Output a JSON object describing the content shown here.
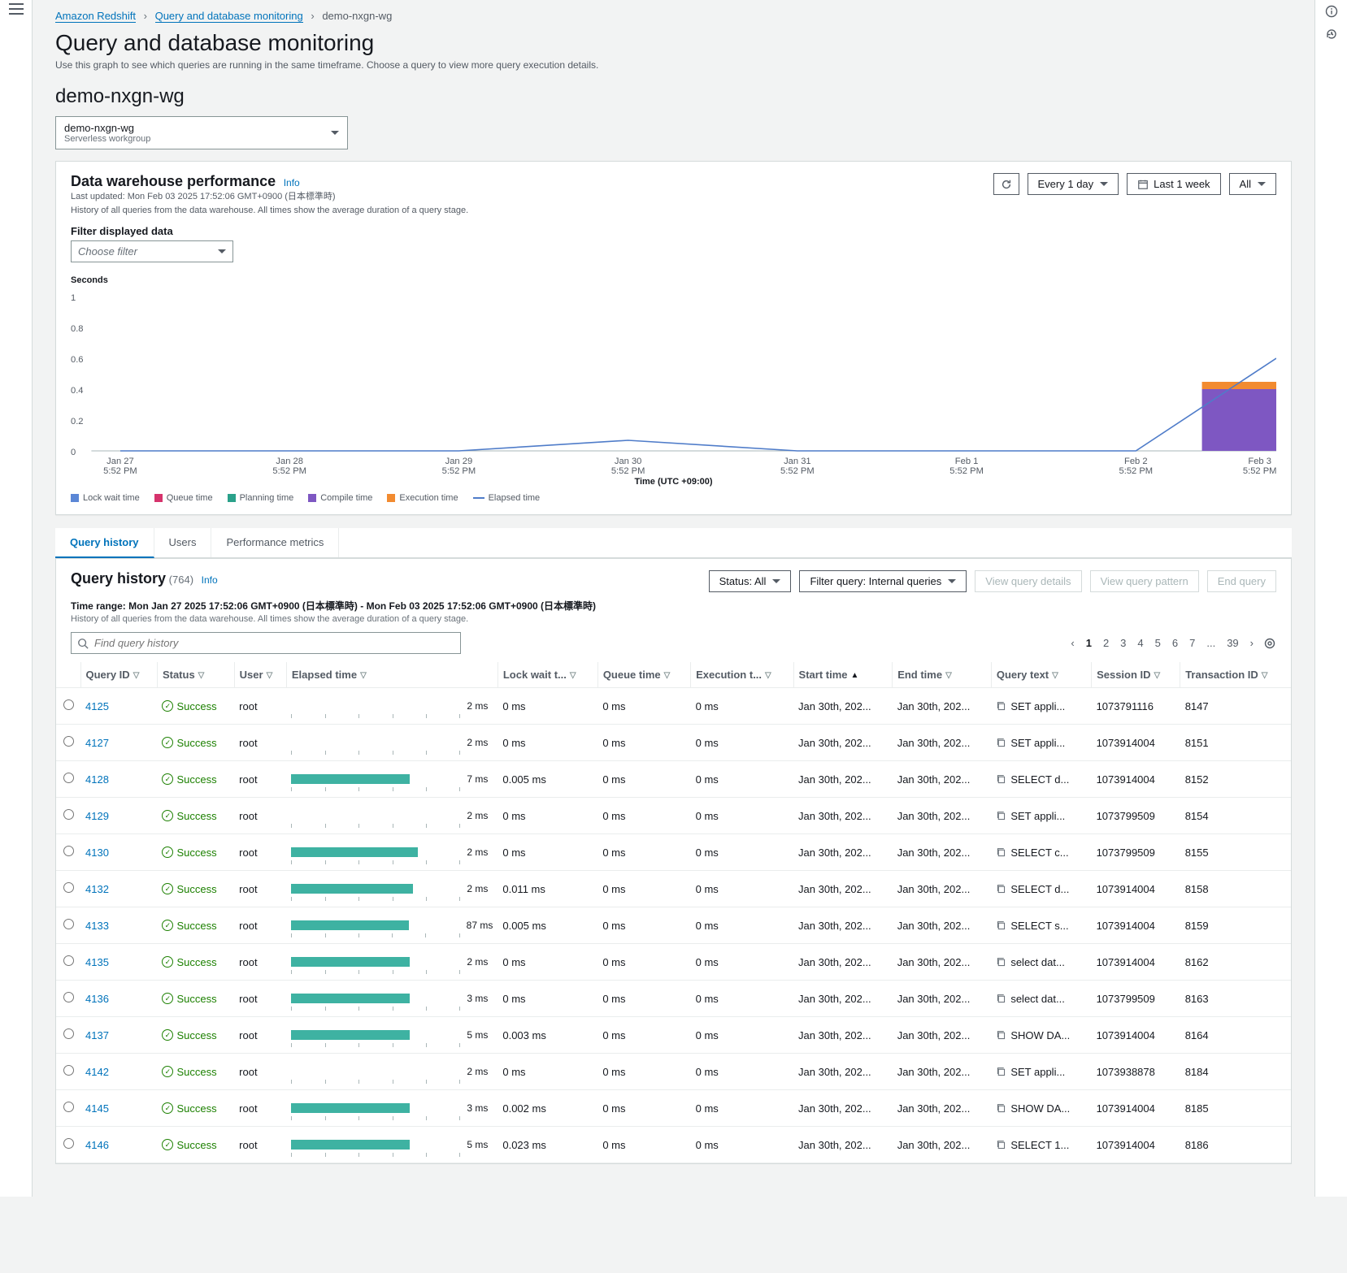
{
  "breadcrumb": {
    "root": "Amazon Redshift",
    "mid": "Query and database monitoring",
    "current": "demo-nxgn-wg"
  },
  "page": {
    "title": "Query and database monitoring",
    "desc": "Use this graph to see which queries are running in the same timeframe. Choose a query to view more query execution details.",
    "section": "demo-nxgn-wg"
  },
  "workgroup": {
    "name": "demo-nxgn-wg",
    "type": "Serverless workgroup"
  },
  "perf": {
    "title": "Data warehouse performance",
    "info": "Info",
    "sub1": "Last updated: Mon Feb 03 2025 17:52:06 GMT+0900 (日本標準時)",
    "sub2": "History of all queries from the data warehouse. All times show the average duration of a query stage.",
    "refresh": "",
    "interval": "Every 1 day",
    "range": "Last 1 week",
    "all": "All",
    "filter_label": "Filter displayed data",
    "filter_placeholder": "Choose filter",
    "ylabel": "Seconds",
    "xlabel": "Time (UTC +09:00)"
  },
  "chart_data": {
    "type": "line",
    "title": "Data warehouse performance",
    "xlabel": "Time (UTC +09:00)",
    "ylabel": "Seconds",
    "ylim": [
      0,
      1
    ],
    "categories": [
      "Jan 27 5:52 PM",
      "Jan 28 5:52 PM",
      "Jan 29 5:52 PM",
      "Jan 30 5:52 PM",
      "Jan 31 5:52 PM",
      "Feb 1 5:52 PM",
      "Feb 2 5:52 PM",
      "Feb 3 5:52 PM"
    ],
    "series": [
      {
        "name": "Lock wait time",
        "type": "bar",
        "color": "#5b87d6",
        "values": [
          0,
          0,
          0,
          0,
          0,
          0,
          0,
          0
        ]
      },
      {
        "name": "Queue time",
        "type": "bar",
        "color": "#d6336c",
        "values": [
          0,
          0,
          0,
          0,
          0,
          0,
          0,
          0
        ]
      },
      {
        "name": "Planning time",
        "type": "bar",
        "color": "#2aa18a",
        "values": [
          0,
          0,
          0,
          0,
          0,
          0,
          0,
          0
        ]
      },
      {
        "name": "Compile time",
        "type": "bar",
        "color": "#7e57c2",
        "values": [
          0,
          0,
          0,
          0,
          0,
          0,
          0,
          0.4
        ]
      },
      {
        "name": "Execution time",
        "type": "bar",
        "color": "#f28b30",
        "values": [
          0,
          0,
          0,
          0,
          0,
          0,
          0,
          0.05
        ]
      },
      {
        "name": "Elapsed time",
        "type": "line",
        "color": "#4f7cc9",
        "values": [
          0,
          0,
          0,
          0.07,
          0,
          0,
          0,
          0.6
        ]
      }
    ],
    "legend": [
      "Lock wait time",
      "Queue time",
      "Planning time",
      "Compile time",
      "Execution time",
      "Elapsed time"
    ]
  },
  "tabs": {
    "t1": "Query history",
    "t2": "Users",
    "t3": "Performance metrics"
  },
  "qh": {
    "title": "Query history",
    "count": "(764)",
    "info": "Info",
    "status_btn": "Status: All",
    "filter_btn": "Filter query: Internal queries",
    "btn_details": "View query details",
    "btn_pattern": "View query pattern",
    "btn_end": "End query",
    "time_range": "Time range: Mon Jan 27 2025 17:52:06 GMT+0900 (日本標準時) - Mon Feb 03 2025 17:52:06 GMT+0900 (日本標準時)",
    "desc": "History of all queries from the data warehouse. All times show the average duration of a query stage.",
    "search_placeholder": "Find query history"
  },
  "pagination": {
    "pages": [
      "1",
      "2",
      "3",
      "4",
      "5",
      "6",
      "7",
      "...",
      "39"
    ]
  },
  "cols": {
    "qid": "Query ID",
    "status": "Status",
    "user": "User",
    "elapsed": "Elapsed time",
    "lock": "Lock wait t...",
    "queue": "Queue time",
    "exec": "Execution t...",
    "start": "Start time",
    "end": "End time",
    "qtext": "Query text",
    "session": "Session ID",
    "txn": "Transaction ID"
  },
  "rows": [
    {
      "id": "4125",
      "status": "Success",
      "user": "root",
      "bar": 0,
      "elapsed": "2 ms",
      "lock": "0 ms",
      "queue": "0 ms",
      "exec": "0 ms",
      "start": "Jan 30th, 202...",
      "end": "Jan 30th, 202...",
      "qtext": "SET appli...",
      "session": "1073791116",
      "txn": "8147"
    },
    {
      "id": "4127",
      "status": "Success",
      "user": "root",
      "bar": 0,
      "elapsed": "2 ms",
      "lock": "0 ms",
      "queue": "0 ms",
      "exec": "0 ms",
      "start": "Jan 30th, 202...",
      "end": "Jan 30th, 202...",
      "qtext": "SET appli...",
      "session": "1073914004",
      "txn": "8151"
    },
    {
      "id": "4128",
      "status": "Success",
      "user": "root",
      "bar": 70,
      "elapsed": "7 ms",
      "lock": "0.005 ms",
      "queue": "0 ms",
      "exec": "0 ms",
      "start": "Jan 30th, 202...",
      "end": "Jan 30th, 202...",
      "qtext": "SELECT d...",
      "session": "1073914004",
      "txn": "8152"
    },
    {
      "id": "4129",
      "status": "Success",
      "user": "root",
      "bar": 0,
      "elapsed": "2 ms",
      "lock": "0 ms",
      "queue": "0 ms",
      "exec": "0 ms",
      "start": "Jan 30th, 202...",
      "end": "Jan 30th, 202...",
      "qtext": "SET appli...",
      "session": "1073799509",
      "txn": "8154"
    },
    {
      "id": "4130",
      "status": "Success",
      "user": "root",
      "bar": 75,
      "elapsed": "2 ms",
      "lock": "0 ms",
      "queue": "0 ms",
      "exec": "0 ms",
      "start": "Jan 30th, 202...",
      "end": "Jan 30th, 202...",
      "qtext": "SELECT c...",
      "session": "1073799509",
      "txn": "8155"
    },
    {
      "id": "4132",
      "status": "Success",
      "user": "root",
      "bar": 72,
      "elapsed": "2 ms",
      "lock": "0.011 ms",
      "queue": "0 ms",
      "exec": "0 ms",
      "start": "Jan 30th, 202...",
      "end": "Jan 30th, 202...",
      "qtext": "SELECT d...",
      "session": "1073914004",
      "txn": "8158"
    },
    {
      "id": "4133",
      "status": "Success",
      "user": "root",
      "bar": 70,
      "elapsed": "87 ms",
      "lock": "0.005 ms",
      "queue": "0 ms",
      "exec": "0 ms",
      "start": "Jan 30th, 202...",
      "end": "Jan 30th, 202...",
      "qtext": "SELECT s...",
      "session": "1073914004",
      "txn": "8159"
    },
    {
      "id": "4135",
      "status": "Success",
      "user": "root",
      "bar": 70,
      "elapsed": "2 ms",
      "lock": "0 ms",
      "queue": "0 ms",
      "exec": "0 ms",
      "start": "Jan 30th, 202...",
      "end": "Jan 30th, 202...",
      "qtext": "select dat...",
      "session": "1073914004",
      "txn": "8162"
    },
    {
      "id": "4136",
      "status": "Success",
      "user": "root",
      "bar": 70,
      "elapsed": "3 ms",
      "lock": "0 ms",
      "queue": "0 ms",
      "exec": "0 ms",
      "start": "Jan 30th, 202...",
      "end": "Jan 30th, 202...",
      "qtext": "select dat...",
      "session": "1073799509",
      "txn": "8163"
    },
    {
      "id": "4137",
      "status": "Success",
      "user": "root",
      "bar": 70,
      "elapsed": "5 ms",
      "lock": "0.003 ms",
      "queue": "0 ms",
      "exec": "0 ms",
      "start": "Jan 30th, 202...",
      "end": "Jan 30th, 202...",
      "qtext": "SHOW DA...",
      "session": "1073914004",
      "txn": "8164"
    },
    {
      "id": "4142",
      "status": "Success",
      "user": "root",
      "bar": 0,
      "elapsed": "2 ms",
      "lock": "0 ms",
      "queue": "0 ms",
      "exec": "0 ms",
      "start": "Jan 30th, 202...",
      "end": "Jan 30th, 202...",
      "qtext": "SET appli...",
      "session": "1073938878",
      "txn": "8184"
    },
    {
      "id": "4145",
      "status": "Success",
      "user": "root",
      "bar": 70,
      "elapsed": "3 ms",
      "lock": "0.002 ms",
      "queue": "0 ms",
      "exec": "0 ms",
      "start": "Jan 30th, 202...",
      "end": "Jan 30th, 202...",
      "qtext": "SHOW DA...",
      "session": "1073914004",
      "txn": "8185"
    },
    {
      "id": "4146",
      "status": "Success",
      "user": "root",
      "bar": 70,
      "elapsed": "5 ms",
      "lock": "0.023 ms",
      "queue": "0 ms",
      "exec": "0 ms",
      "start": "Jan 30th, 202...",
      "end": "Jan 30th, 202...",
      "qtext": "SELECT 1...",
      "session": "1073914004",
      "txn": "8186"
    }
  ]
}
